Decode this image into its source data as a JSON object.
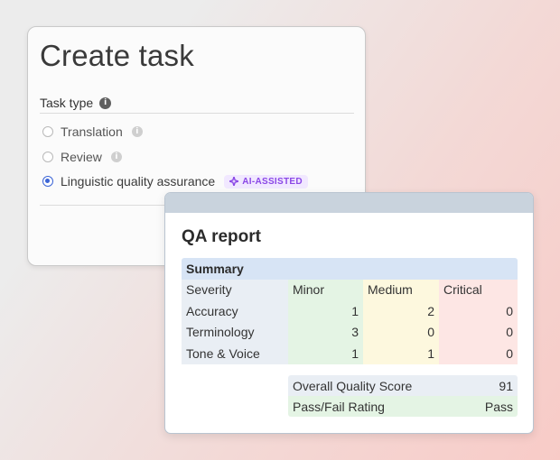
{
  "create_task": {
    "title": "Create task",
    "task_type_label": "Task type",
    "options": [
      {
        "label": "Translation",
        "checked": false,
        "info": true
      },
      {
        "label": "Review",
        "checked": false,
        "info": true
      },
      {
        "label": "Linguistic quality assurance",
        "checked": true,
        "badge": "AI-ASSISTED"
      }
    ]
  },
  "qa_report": {
    "title": "QA report",
    "summary_label": "Summary",
    "columns": [
      "Severity",
      "Minor",
      "Medium",
      "Critical"
    ],
    "rows": [
      {
        "label": "Accuracy",
        "minor": "1",
        "medium": "2",
        "critical": "0"
      },
      {
        "label": "Terminology",
        "minor": "3",
        "medium": "0",
        "critical": "0"
      },
      {
        "label": "Tone & Voice",
        "minor": "1",
        "medium": "1",
        "critical": "0"
      }
    ],
    "overall_quality_label": "Overall Quality Score",
    "overall_quality_value": "91",
    "pass_fail_label": "Pass/Fail Rating",
    "pass_fail_value": "Pass"
  },
  "colors": {
    "accent_radio": "#3b64d6",
    "ai_badge_text": "#8a47e6",
    "ai_badge_bg": "#f1e8ff",
    "summary_header": "#d7e4f5",
    "minor_col": "#e4f4e4",
    "medium_col": "#fdf8de",
    "critical_col": "#fde6e4"
  },
  "icons": {
    "info": "info-icon",
    "badge": "sparkle-icon"
  }
}
